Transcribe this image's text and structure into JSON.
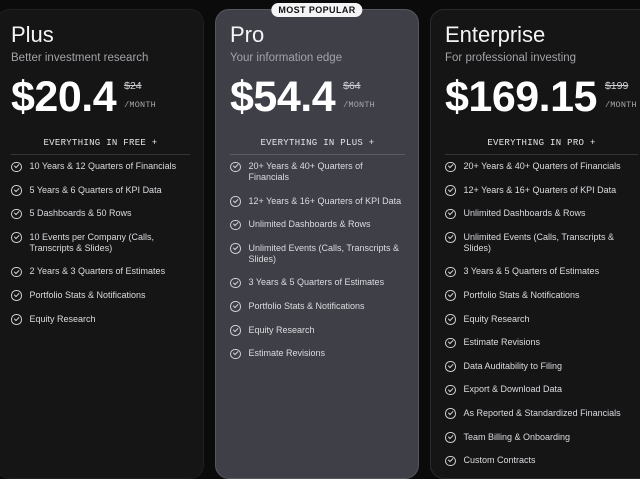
{
  "plans": [
    {
      "name": "Plus",
      "tagline": "Better investment research",
      "price": "$20.4",
      "old_price": "$24",
      "period": "/MONTH",
      "includes": "EVERYTHING IN FREE +",
      "features": [
        "10 Years & 12 Quarters of Financials",
        "5 Years & 6 Quarters of KPI Data",
        "5 Dashboards & 50 Rows",
        "10 Events per Company (Calls, Transcripts & Slides)",
        "2 Years & 3 Quarters of Estimates",
        "Portfolio Stats & Notifications",
        "Equity Research"
      ]
    },
    {
      "name": "Pro",
      "badge": "MOST POPULAR",
      "tagline": "Your information edge",
      "price": "$54.4",
      "old_price": "$64",
      "period": "/MONTH",
      "includes": "EVERYTHING IN PLUS +",
      "features": [
        "20+ Years & 40+ Quarters of Financials",
        "12+ Years & 16+ Quarters of KPI Data",
        "Unlimited Dashboards & Rows",
        "Unlimited Events (Calls, Transcripts & Slides)",
        "3 Years & 5 Quarters of Estimates",
        "Portfolio Stats & Notifications",
        "Equity Research",
        "Estimate Revisions"
      ]
    },
    {
      "name": "Enterprise",
      "tagline": "For professional investing",
      "price": "$169.15",
      "old_price": "$199",
      "period": "/MONTH",
      "includes": "EVERYTHING IN PRO +",
      "features": [
        "20+ Years & 40+ Quarters of Financials",
        "12+ Years & 16+ Quarters of KPI Data",
        "Unlimited Dashboards & Rows",
        "Unlimited Events (Calls, Transcripts & Slides)",
        "3 Years & 5 Quarters of Estimates",
        "Portfolio Stats & Notifications",
        "Equity Research",
        "Estimate Revisions",
        "Data Auditability to Filing",
        "Export & Download Data",
        "As Reported & Standardized Financials",
        "Team Billing & Onboarding",
        "Custom Contracts"
      ]
    }
  ],
  "colors": {
    "background": "#0b0b0c",
    "card": "#151516",
    "highlight_card": "#3e3f47",
    "badge": "#f4f4f6"
  },
  "icons": {
    "feature_bullet": "check-circle-icon"
  }
}
